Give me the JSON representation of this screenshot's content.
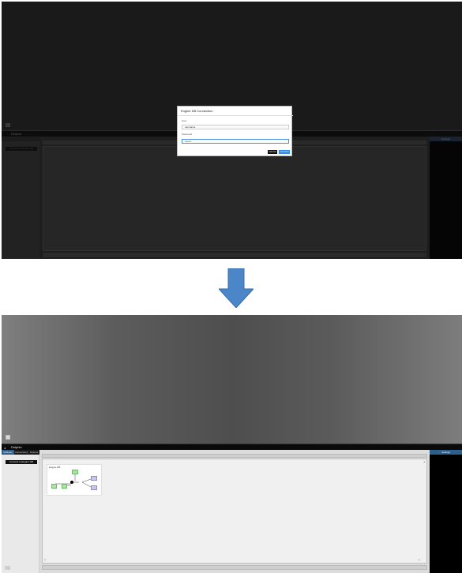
{
  "colors": {
    "accent": "#2e8ae6",
    "tab_active": "#2e5e8a",
    "arrow": "#4a86c8",
    "node_green": "#a8e6a0",
    "node_purple": "#c8c8e6"
  },
  "before": {
    "app_title": "Dolphin",
    "tabs": [
      "Modules",
      "Connections",
      "Options"
    ],
    "left_button": "Connect to Engine DB",
    "right_panel_title": "Settings",
    "dialog": {
      "title": "Engine DB Connection",
      "user_label": "User",
      "user_value": "username",
      "password_label": "Password",
      "password_value": "••••••••",
      "cancel_label": "Cancel",
      "connect_label": "Connect"
    }
  },
  "after": {
    "app_title": "Dolphin",
    "tabs": [
      "Modules",
      "Connections",
      "Options"
    ],
    "left_button": "Connect to Engine DB",
    "right_panel_title": "Settings",
    "canvas_breadcrumb": "Engine DB",
    "icons": {
      "menu": "menu-icon",
      "arrow": "down-arrow-icon"
    }
  }
}
